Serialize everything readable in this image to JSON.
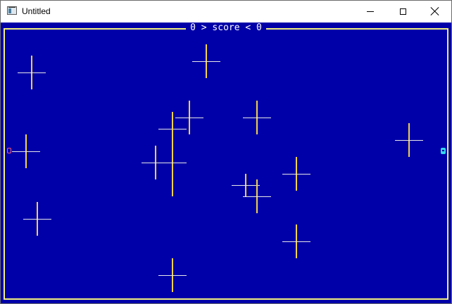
{
  "window": {
    "title": "Untitled",
    "icon": "app-window-icon",
    "controls": [
      "minimize-icon",
      "maximize-icon",
      "close-icon"
    ]
  },
  "game": {
    "score_text": "0 > score < 0",
    "colors": {
      "background": "#0000a8",
      "frame": "#f2ef80",
      "plus_vertical": "#f3d24a",
      "plus_horizontal": "#e8e8e8",
      "left_paddle": "#ff5a7a",
      "right_paddle": "#35d6ee"
    }
  }
}
